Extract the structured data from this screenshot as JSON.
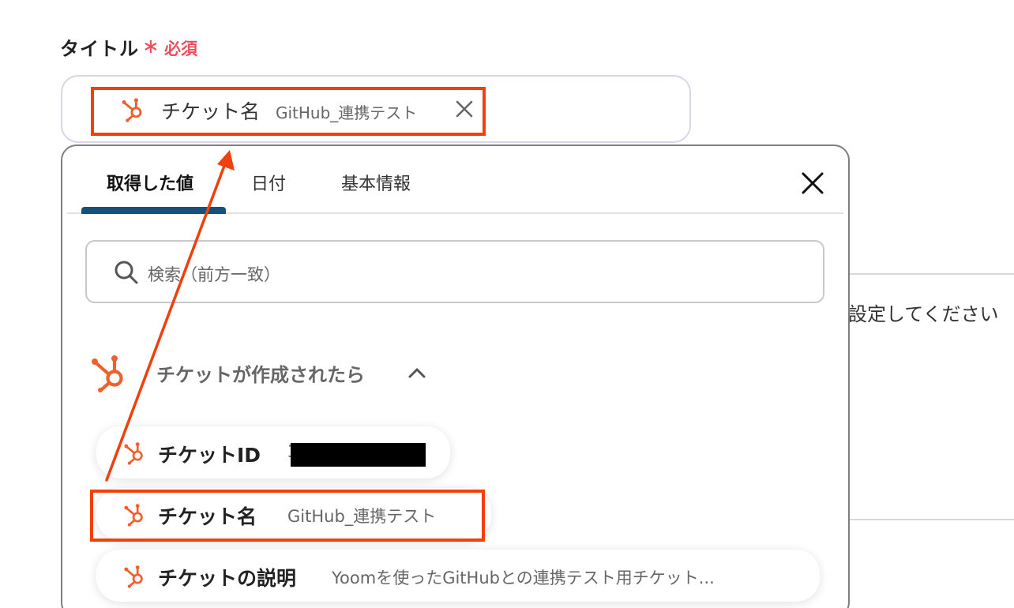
{
  "field": {
    "label": "タイトル",
    "required_mark": "∗",
    "required_text": "必須"
  },
  "token": {
    "icon": "hubspot-icon",
    "name": "チケット名",
    "value": "GitHub_連携テスト",
    "remove_icon": "close-icon"
  },
  "popup": {
    "tabs": [
      {
        "label": "取得した値",
        "active": true
      },
      {
        "label": "日付",
        "active": false
      },
      {
        "label": "基本情報",
        "active": false
      }
    ],
    "close_icon": "close-icon",
    "search": {
      "placeholder": "検索（前方一致）",
      "icon": "search-icon"
    },
    "group": {
      "title": "チケットが作成されたら",
      "icon": "hubspot-icon",
      "expanded": true,
      "items": [
        {
          "name": "チケットID",
          "value": "3",
          "redacted": true
        },
        {
          "name": "チケット名",
          "value": "GitHub_連携テスト",
          "highlighted": true
        },
        {
          "name": "チケットの説明",
          "value": "Yoomを使ったGitHubとの連携テスト用チケット..."
        }
      ]
    }
  },
  "background": {
    "partial_text": "設定してください"
  },
  "colors": {
    "highlight": "#f0400c",
    "hubspot": "#f0602d",
    "tab_underline": "#12527e",
    "required": "#e8505b"
  }
}
